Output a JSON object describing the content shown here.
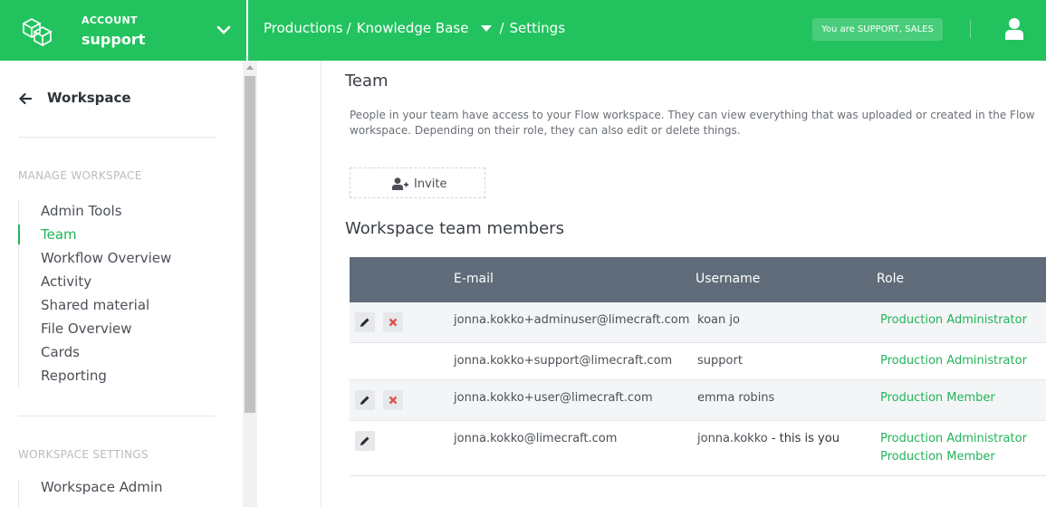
{
  "header": {
    "account_label": "ACCOUNT",
    "account_name": "support",
    "breadcrumbs": [
      "Productions",
      "Knowledge Base",
      "Settings"
    ],
    "separator": "/",
    "role_badge": "You are SUPPORT, SALES",
    "icons": [
      "logo-icon",
      "chevron-down-icon",
      "caret-down-icon",
      "user-icon"
    ]
  },
  "sidebar": {
    "back_label": "Workspace",
    "section_manage": "MANAGE WORKSPACE",
    "items": [
      {
        "label": "Admin Tools",
        "active": false
      },
      {
        "label": "Team",
        "active": true
      },
      {
        "label": "Workflow Overview",
        "active": false
      },
      {
        "label": "Activity",
        "active": false
      },
      {
        "label": "Shared material",
        "active": false
      },
      {
        "label": "File Overview",
        "active": false
      },
      {
        "label": "Cards",
        "active": false
      },
      {
        "label": "Reporting",
        "active": false
      }
    ],
    "section_settings": "WORKSPACE SETTINGS",
    "settings_items": [
      {
        "label": "Workspace Admin"
      }
    ]
  },
  "main": {
    "title": "Team",
    "description": "People in your team have access to your Flow workspace. They can view everything that was uploaded or created in the Flow workspace. Depending on their role, they can also edit or delete things.",
    "invite_label": "Invite",
    "members_title": "Workspace team members",
    "columns": {
      "email": "E-mail",
      "username": "Username",
      "role": "Role"
    },
    "rows": [
      {
        "email": "jonna.kokko+adminuser@limecraft.com",
        "username": "koan jo",
        "you_suffix": "",
        "roles": [
          "Production Administrator"
        ],
        "edit": true,
        "delete": true
      },
      {
        "email": "jonna.kokko+support@limecraft.com",
        "username": "support",
        "you_suffix": "",
        "roles": [
          "Production Administrator"
        ],
        "edit": false,
        "delete": false
      },
      {
        "email": "jonna.kokko+user@limecraft.com",
        "username": "emma robins",
        "you_suffix": "",
        "roles": [
          "Production Member"
        ],
        "edit": true,
        "delete": true
      },
      {
        "email": "jonna.kokko@limecraft.com",
        "username": "jonna.kokko",
        "you_suffix": " - this is you",
        "roles": [
          "Production Administrator",
          "Production Member"
        ],
        "edit": true,
        "delete": false
      }
    ]
  },
  "colors": {
    "brand": "#22c35e",
    "accent": "#22b45a",
    "table_header": "#5f6b78",
    "delete": "#d9534f"
  }
}
